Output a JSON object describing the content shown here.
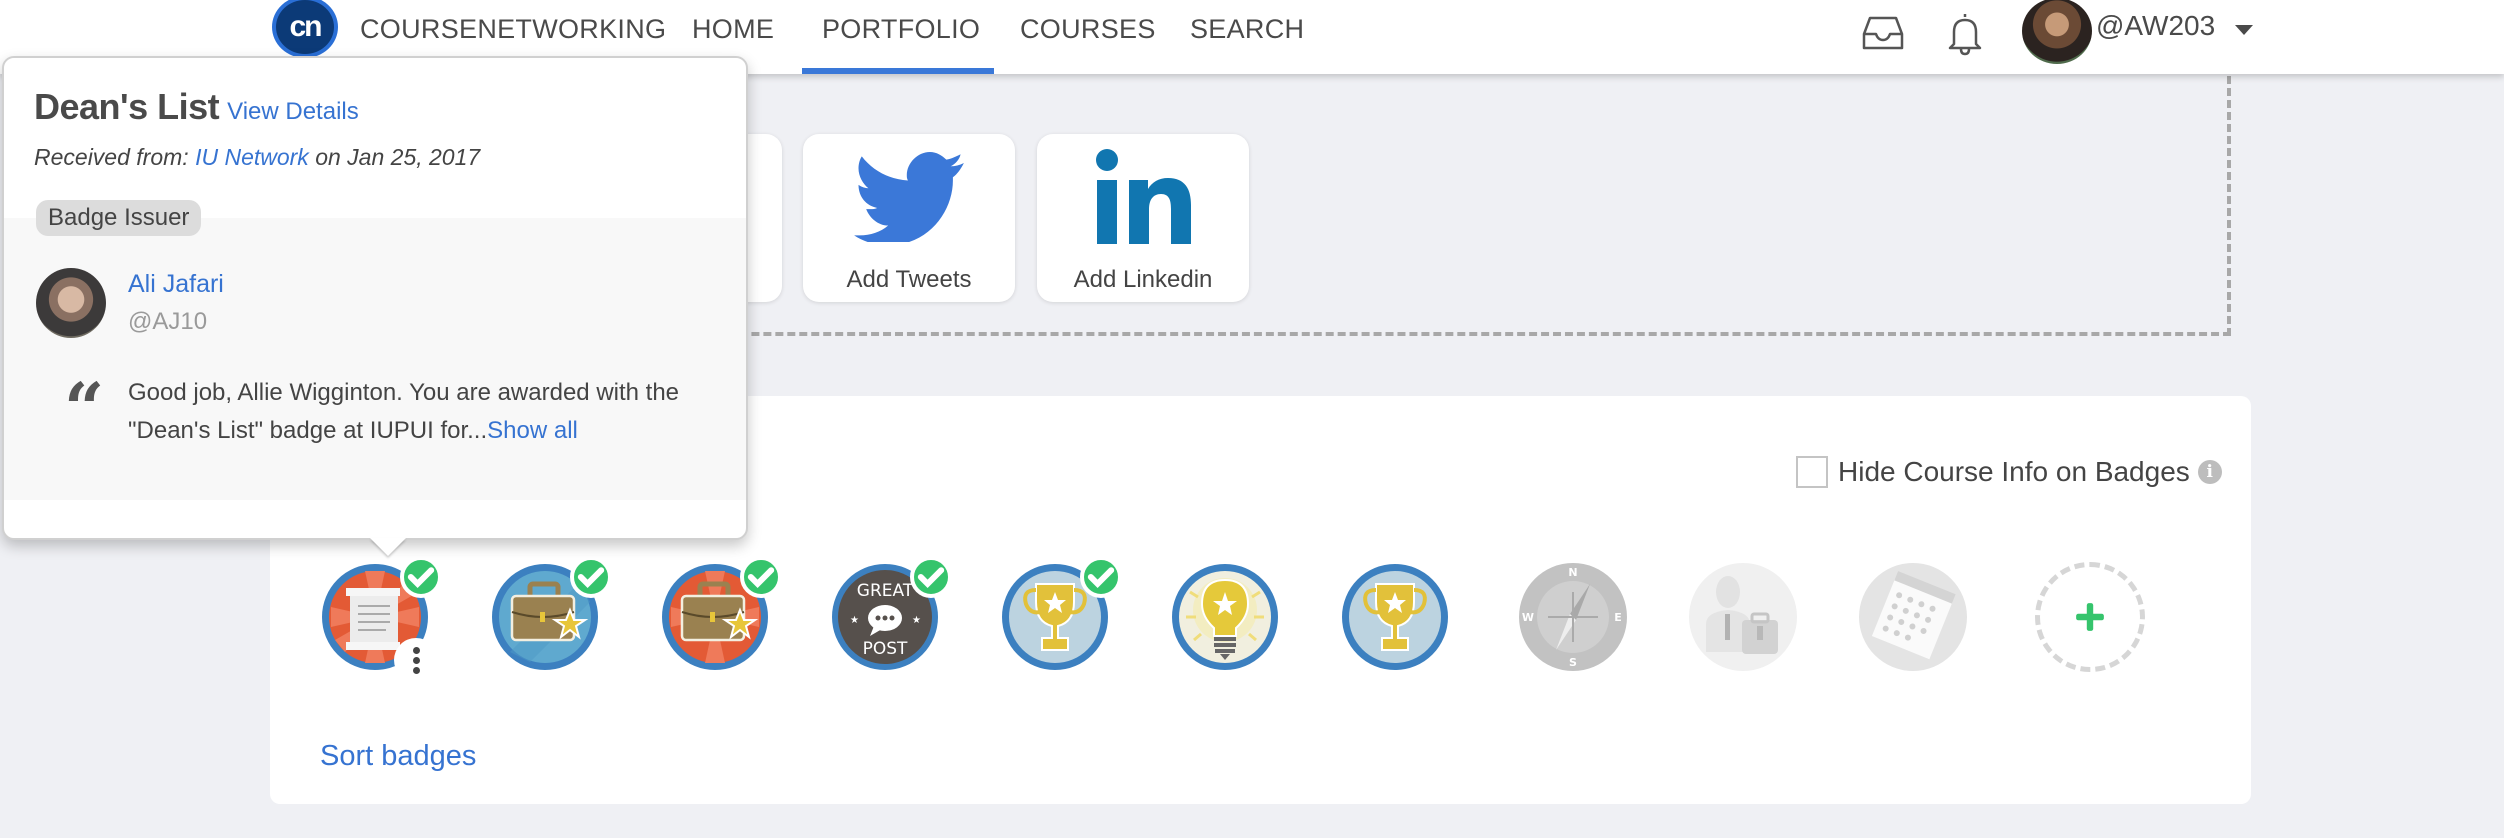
{
  "nav": {
    "logo_text": "cn",
    "items": [
      {
        "label": "COURSENETWORKING"
      },
      {
        "label": "HOME"
      },
      {
        "label": "PORTFOLIO",
        "active": true
      },
      {
        "label": "COURSES"
      },
      {
        "label": "SEARCH"
      }
    ],
    "inbox_icon": "inbox-icon",
    "bell_icon": "bell-icon",
    "username": "@AW203"
  },
  "imports": {
    "tiles": [
      {
        "label": "Add Tweets",
        "icon": "twitter-icon",
        "color": "#3b78d8"
      },
      {
        "label": "Add Linkedin",
        "icon": "linkedin-icon",
        "color": "#1176b0"
      }
    ]
  },
  "badges_panel": {
    "hide_course_info_label": "Hide Course Info on Badges",
    "hide_course_info_checked": false,
    "sort_label": "Sort badges",
    "badges": [
      {
        "name": "dean-list",
        "type": "scroll",
        "earned": true,
        "has_menu": true
      },
      {
        "name": "portfolio-blue",
        "type": "briefcase-blue",
        "earned": true
      },
      {
        "name": "portfolio-red",
        "type": "briefcase-red",
        "earned": true
      },
      {
        "name": "great-post",
        "type": "great-post",
        "earned": true,
        "text_top": "GREAT",
        "text_bottom": "POST"
      },
      {
        "name": "trophy-earned",
        "type": "trophy",
        "earned": true
      },
      {
        "name": "idea",
        "type": "lightbulb",
        "earned": false
      },
      {
        "name": "trophy",
        "type": "trophy",
        "earned": false
      },
      {
        "name": "compass",
        "type": "compass",
        "locked": true,
        "compass_labels": [
          "N",
          "E",
          "S",
          "W"
        ]
      },
      {
        "name": "professional",
        "type": "person",
        "locked": true
      },
      {
        "name": "calendar",
        "type": "calendar",
        "locked": true
      }
    ],
    "colors": {
      "accent": "#3673d1",
      "check": "#35c46c"
    }
  },
  "popover": {
    "title": "Dean's List",
    "view_details": "View Details",
    "received_prefix": "Received from: ",
    "received_from": "IU Network",
    "received_suffix": " on Jan 25, 2017",
    "issuer_tag": "Badge Issuer",
    "issuer_name": "Ali Jafari",
    "issuer_handle": "@AJ10",
    "quote": "Good job, Allie Wigginton. You are awarded with the \"Dean's List\" badge at IUPUI for...",
    "show_all": "Show all"
  }
}
